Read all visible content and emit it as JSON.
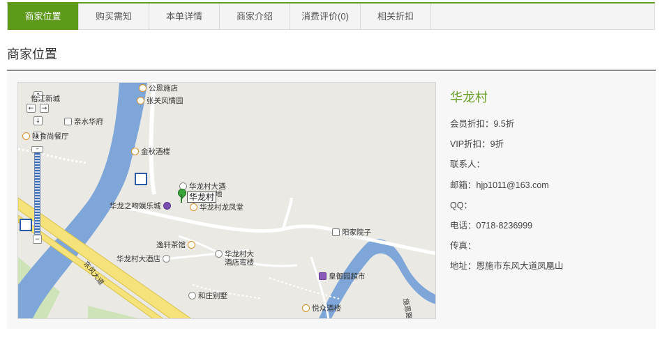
{
  "tabs": [
    {
      "label": "商家位置",
      "active": true
    },
    {
      "label": "购买需知",
      "active": false
    },
    {
      "label": "本单详情",
      "active": false
    },
    {
      "label": "商家介绍",
      "active": false
    },
    {
      "label": "消费评价(0)",
      "active": false
    },
    {
      "label": "相关折扣",
      "active": false
    }
  ],
  "section_title": "商家位置",
  "map": {
    "marker_label": "华龙村",
    "pois": [
      {
        "name": "公恩施店",
        "icon": "food-icon"
      },
      {
        "name": "张关风情园",
        "icon": "food-icon"
      },
      {
        "name": "怡江新城",
        "icon": ""
      },
      {
        "name": "亲水华府",
        "icon": "house-icon"
      },
      {
        "name": "味食尚餐厅",
        "icon": "food-icon"
      },
      {
        "name": "金秋酒楼",
        "icon": "food-icon"
      },
      {
        "name": "华龙村大酒",
        "icon": "hotel-icon"
      },
      {
        "name": "地",
        "icon": ""
      },
      {
        "name": "华龙之吻娱乐城",
        "icon": "entertainment-icon"
      },
      {
        "name": "华龙村龙凤堂",
        "icon": "food-icon"
      },
      {
        "name": "阳家院子",
        "icon": "house-icon"
      },
      {
        "name": "逸轩茶馆",
        "icon": "food-icon"
      },
      {
        "name": "华龙村大酒店",
        "icon": "hotel-icon"
      },
      {
        "name": "华龙村大",
        "icon": "hotel-icon"
      },
      {
        "name": "酒店弯楼",
        "icon": ""
      },
      {
        "name": "皇御园超市",
        "icon": "shop-icon"
      },
      {
        "name": "和庄别墅",
        "icon": "hotel-icon"
      },
      {
        "name": "悦众酒楼",
        "icon": "food-icon"
      }
    ],
    "road_label": "东风大道",
    "road_label_2": "施恩路"
  },
  "shop": {
    "name": "华龙村",
    "discount": "会员折扣：9.5折",
    "vip_discount": "VIP折扣：9折",
    "contact": "联系人：",
    "email": "邮箱：hjp1011@163.com",
    "qq": "QQ：",
    "phone": "电话：0718-8236999",
    "fax": "传真：",
    "address": "地址：恩施市东风大道凤凰山"
  },
  "colors": {
    "accent": "#5e9a19",
    "shop_name": "#6aa02a",
    "river": "#7ea6d8"
  }
}
